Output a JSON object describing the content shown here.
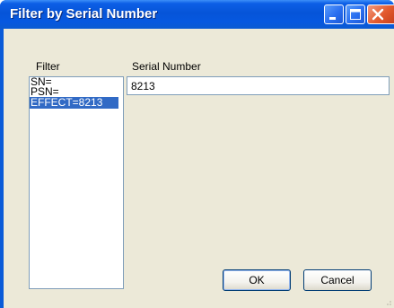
{
  "window": {
    "title": "Filter by Serial Number"
  },
  "titlebar_buttons": [
    "minimize-icon",
    "maximize-icon",
    "close-icon"
  ],
  "filter": {
    "label": "Filter",
    "items": [
      "SN=",
      "PSN=",
      "EFFECT=8213"
    ],
    "selected_index": 2
  },
  "serial": {
    "label": "Serial Number",
    "value": "8213"
  },
  "buttons": {
    "ok": "OK",
    "cancel": "Cancel"
  },
  "colors": {
    "selection": "#316ac5",
    "titlebar": "#0654d8",
    "close": "#e35a2e",
    "face": "#ece9d8"
  }
}
